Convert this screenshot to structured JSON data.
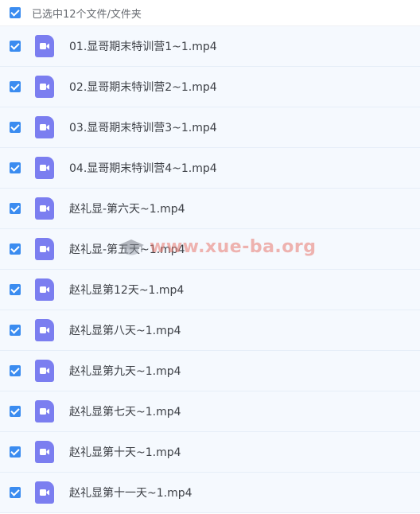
{
  "header": {
    "selection_text": "已选中12个文件/文件夹"
  },
  "files": [
    {
      "name": "01.显哥期末特训营1~1.mp4"
    },
    {
      "name": "02.显哥期末特训营2~1.mp4"
    },
    {
      "name": "03.显哥期末特训营3~1.mp4"
    },
    {
      "name": "04.显哥期末特训营4~1.mp4"
    },
    {
      "name": "赵礼显-第六天~1.mp4"
    },
    {
      "name": "赵礼显-第五天~1.mp4"
    },
    {
      "name": "赵礼显第12天~1.mp4"
    },
    {
      "name": "赵礼显第八天~1.mp4"
    },
    {
      "name": "赵礼显第九天~1.mp4"
    },
    {
      "name": "赵礼显第七天~1.mp4"
    },
    {
      "name": "赵礼显第十天~1.mp4"
    },
    {
      "name": "赵礼显第十一天~1.mp4"
    }
  ],
  "watermark": {
    "text": "www.xue-ba.org"
  },
  "colors": {
    "checkbox": "#3b8cf0",
    "video_icon": "#7b7ef0",
    "row_bg": "#f5f9fe"
  },
  "icons": {
    "checkbox": "checkbox-checked-icon",
    "file": "video-file-icon",
    "watermark": "graduation-cap-icon"
  }
}
